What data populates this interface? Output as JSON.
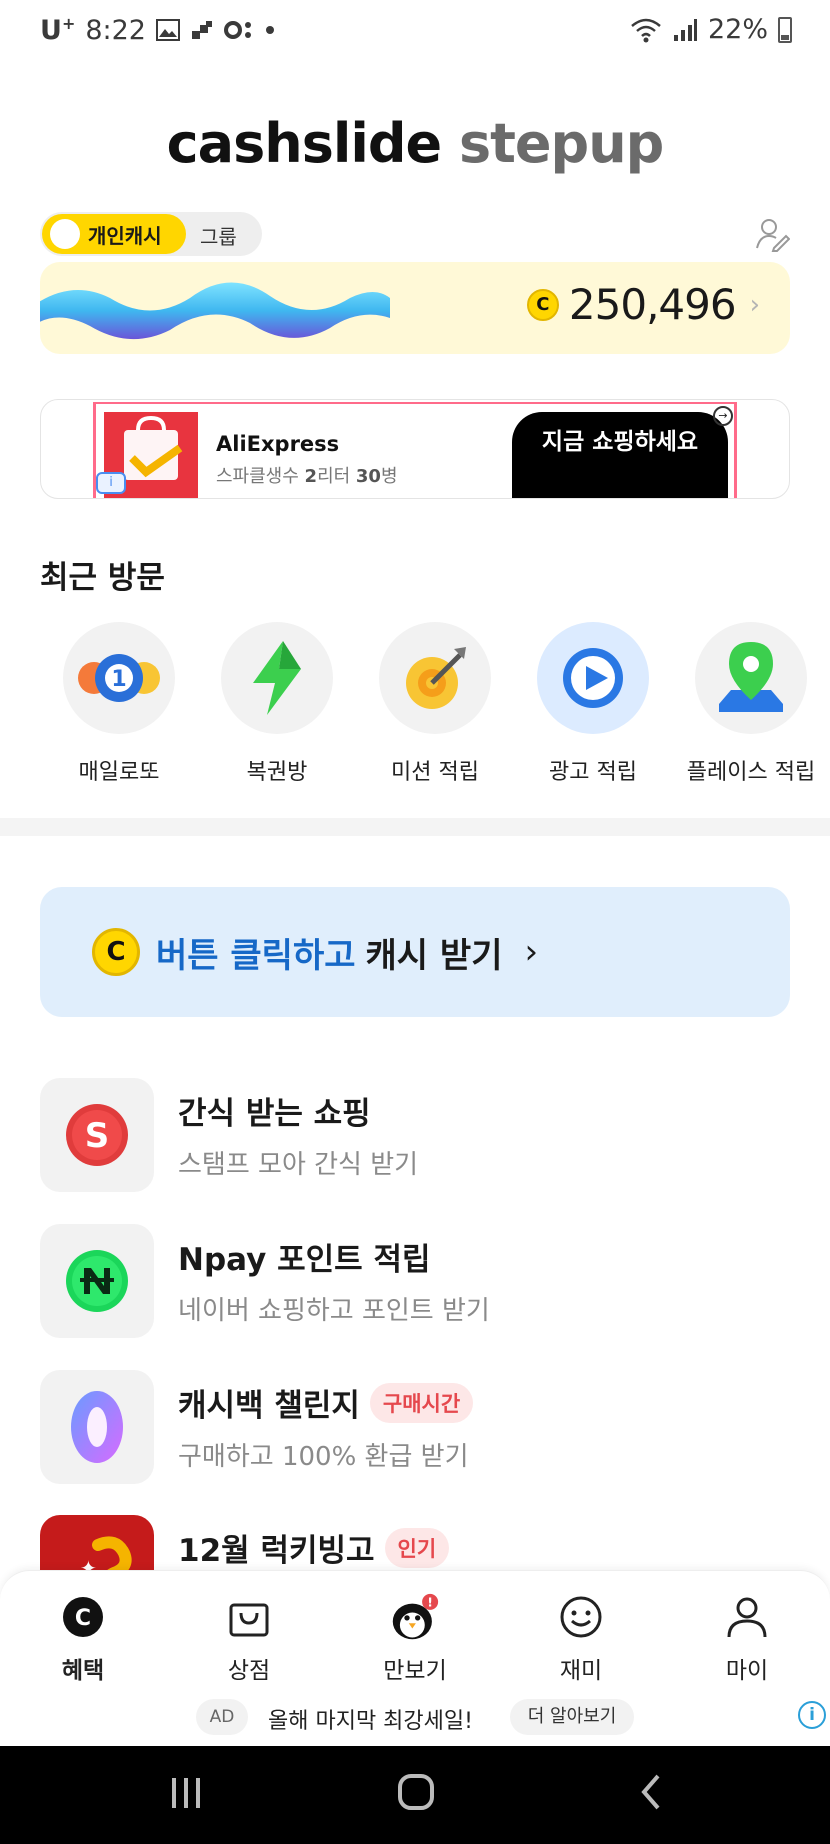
{
  "status_bar": {
    "carrier": "U",
    "carrier_sup": "+",
    "time": "8:22",
    "battery": "22%"
  },
  "logo": {
    "part1": "cashslide",
    "part2": "stepup"
  },
  "toggle": {
    "active_label": "개인캐시",
    "inactive_label": "그룹"
  },
  "cash": {
    "coin": "C",
    "amount": "250,496",
    "chevron": "›"
  },
  "ad_banner": {
    "title": "AliExpress",
    "subtitle_pre": "스파클생수 ",
    "subtitle_b1": "2",
    "subtitle_mid": "리터 ",
    "subtitle_b2": "30",
    "subtitle_post": "병",
    "cta": "지금 쇼핑하세요",
    "info": "i",
    "close": "→"
  },
  "recent": {
    "title": "최근 방문",
    "items": [
      {
        "label": "매일로또",
        "icon": "lotto-ball-icon"
      },
      {
        "label": "복권방",
        "icon": "lightning-icon"
      },
      {
        "label": "미션 적립",
        "icon": "target-icon"
      },
      {
        "label": "광고 적립",
        "icon": "play-icon"
      },
      {
        "label": "플레이스 적립",
        "icon": "map-pin-icon"
      }
    ]
  },
  "click_banner": {
    "coin": "C",
    "highlight": "버튼 클릭하고",
    "rest": "캐시 받기",
    "chevron": "›"
  },
  "features": [
    {
      "title": "간식 받는 쇼핑",
      "subtitle": "스탬프 모아 간식 받기",
      "badge": "",
      "icon": "s-coin-icon"
    },
    {
      "title": "Npay 포인트 적립",
      "subtitle": "네이버 쇼핑하고 포인트 받기",
      "badge": "",
      "icon": "npay-icon"
    },
    {
      "title": "캐시백 챌린지",
      "subtitle": "구매하고 100% 환급 받기",
      "badge": "구매시간",
      "icon": "zero-icon"
    },
    {
      "title": "12월 럭키빙고",
      "subtitle": "",
      "badge": "인기",
      "icon": "bingo-icon"
    }
  ],
  "bottom_nav": [
    {
      "label": "혜택",
      "icon": "c-coin-icon",
      "active": true
    },
    {
      "label": "상점",
      "icon": "shopping-bag-icon",
      "active": false
    },
    {
      "label": "만보기",
      "icon": "penguin-icon",
      "active": false
    },
    {
      "label": "재미",
      "icon": "smile-icon",
      "active": false
    },
    {
      "label": "마이",
      "icon": "person-icon",
      "active": false
    }
  ],
  "bottom_ad": {
    "tag": "AD",
    "text": "올해 마지막 최강세일!",
    "more": "더 알아보기",
    "info": "i"
  },
  "colors": {
    "accent_yellow": "#ffd600",
    "accent_blue": "#1668c7",
    "badge_red": "#e5484d"
  }
}
